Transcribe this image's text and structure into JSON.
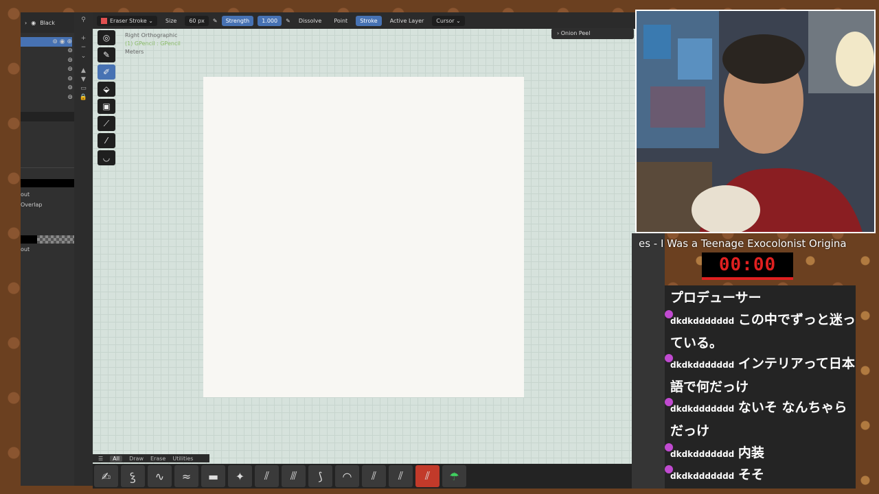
{
  "outliner": {
    "header_label": "Black",
    "labels": [
      "out",
      "Overlap",
      "out"
    ]
  },
  "header": {
    "tool": "Eraser Stroke",
    "size_label": "Size",
    "size_value": "60 px",
    "strength_label": "Strength",
    "strength_value": "1.000",
    "dissolve": "Dissolve",
    "point": "Point",
    "stroke": "Stroke",
    "active_layer": "Active Layer",
    "cursor": "Cursor"
  },
  "viewport": {
    "view_name": "Right Orthographic",
    "object": "(1) GPencil : GPencil",
    "units": "Meters",
    "onion_peel": "Onion Peel"
  },
  "brush_tabs": [
    "All",
    "Draw",
    "Erase",
    "Utilities"
  ],
  "stream": {
    "song": "es - I Was a Teenage Exocolonist Origina",
    "timer": "00:00",
    "chat": [
      {
        "user": "",
        "text": "プロデューサー"
      },
      {
        "user": "dkdkddddddd",
        "text": "この中でずっと迷っている。"
      },
      {
        "user": "dkdkddddddd",
        "text": "インテリアって日本語で何だっけ"
      },
      {
        "user": "dkdkddddddd",
        "text": "ないそ なんちゃらだっけ"
      },
      {
        "user": "dkdkddddddd",
        "text": "内装"
      },
      {
        "user": "dkdkddddddd",
        "text": "そそ"
      }
    ]
  },
  "colors": {
    "accent": "#4772b3",
    "eraser_active": "#c23a2a",
    "timer": "#e02020"
  }
}
